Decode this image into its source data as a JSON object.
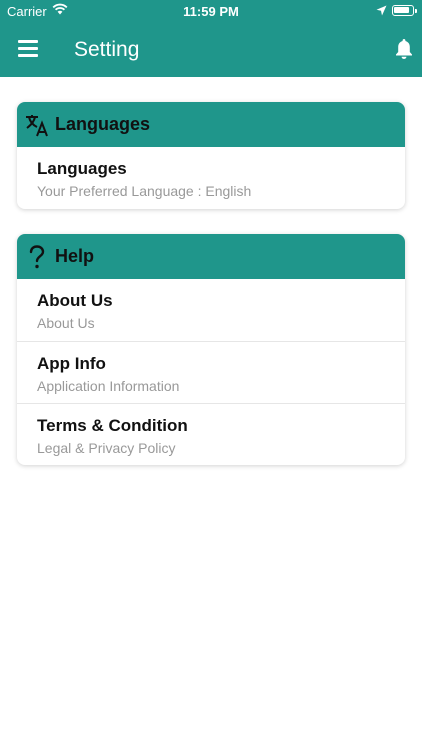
{
  "status_bar": {
    "carrier": "Carrier",
    "time": "11:59 PM",
    "battery_level": 0.9
  },
  "header": {
    "title": "Setting",
    "menu_icon": "hamburger-menu-icon",
    "notification_icon": "bell-icon",
    "color": "#1f968b"
  },
  "languages_section": {
    "title": "Languages",
    "icon": "translate-icon",
    "items": [
      {
        "title": "Languages",
        "subtitle": "Your Preferred Language : English"
      }
    ]
  },
  "help_section": {
    "title": "Help",
    "icon": "question-mark-icon",
    "items": [
      {
        "title": "About Us",
        "subtitle": "About Us"
      },
      {
        "title": "App Info",
        "subtitle": "Application Information"
      },
      {
        "title": "Terms & Condition",
        "subtitle": "Legal & Privacy Policy"
      }
    ]
  }
}
